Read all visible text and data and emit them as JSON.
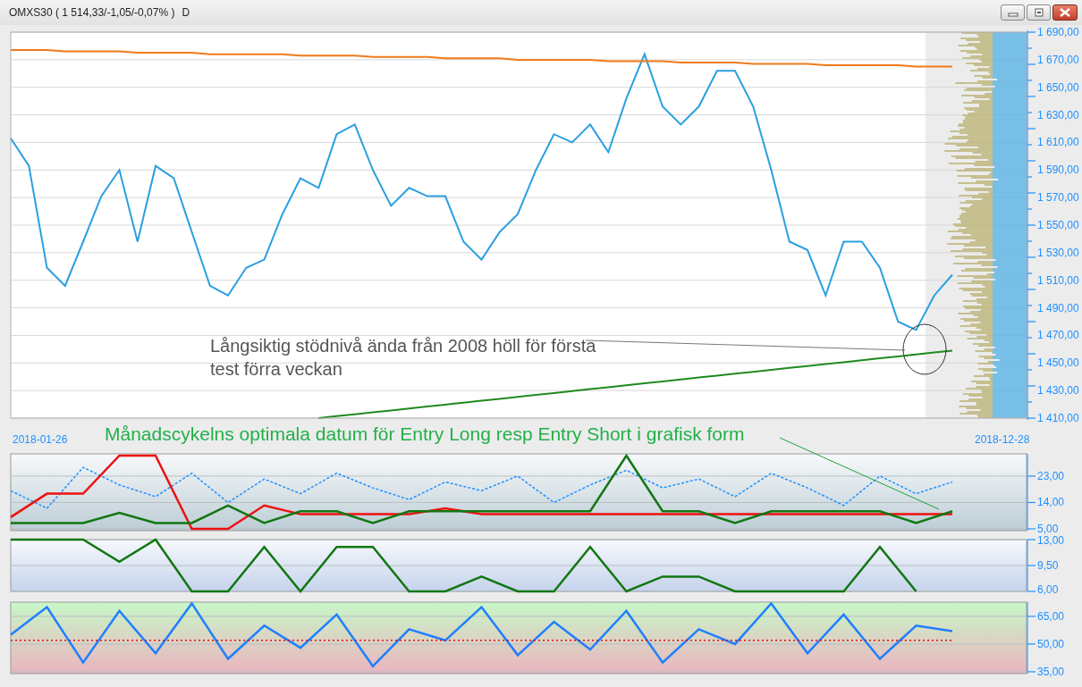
{
  "window": {
    "title": "OMXS30 ( 1 514,33/-1,05/-0,07% )",
    "period": "D"
  },
  "price_chart": {
    "start_date": "2018-01-26",
    "end_date": "2018-12-28",
    "note": "Långsiktig stödnivå ända från 2008 höll för första test förra veckan",
    "chart_data": {
      "type": "line",
      "grid": true,
      "ylim": [
        1410,
        1690
      ],
      "yticks": [
        {
          "value": 1690,
          "label": "1 690,00"
        },
        {
          "value": 1670,
          "label": "1 670,00"
        },
        {
          "value": 1650,
          "label": "1 650,00"
        },
        {
          "value": 1630,
          "label": "1 630,00"
        },
        {
          "value": 1610,
          "label": "1 610,00"
        },
        {
          "value": 1590,
          "label": "1 590,00"
        },
        {
          "value": 1570,
          "label": "1 570,00"
        },
        {
          "value": 1550,
          "label": "1 550,00"
        },
        {
          "value": 1530,
          "label": "1 530,00"
        },
        {
          "value": 1510,
          "label": "1 510,00"
        },
        {
          "value": 1490,
          "label": "1 490,00"
        },
        {
          "value": 1470,
          "label": "1 470,00"
        },
        {
          "value": 1450,
          "label": "1 450,00"
        },
        {
          "value": 1430,
          "label": "1 430,00"
        },
        {
          "value": 1410,
          "label": "1 410,00"
        }
      ],
      "series": [
        {
          "color": "#2a9fe0",
          "line_style": "solid",
          "values": [
            1613,
            1593,
            1519,
            1506,
            1538,
            1571,
            1590,
            1538,
            1593,
            1584,
            1545,
            1506,
            1499,
            1519,
            1525,
            1558,
            1584,
            1577,
            1616,
            1623,
            1590,
            1564,
            1577,
            1571,
            1571,
            1538,
            1525,
            1545,
            1558,
            1590,
            1616,
            1610,
            1623,
            1603,
            1642,
            1674,
            1636,
            1623,
            1636,
            1662,
            1662,
            1636,
            1590,
            1538,
            1532,
            1499,
            1538,
            1538,
            1519,
            1480,
            1474,
            1499,
            1514
          ]
        },
        {
          "color": "#f07a1a",
          "line_style": "solid",
          "values": [
            1677,
            1677,
            1677,
            1676,
            1676,
            1676,
            1676,
            1675,
            1675,
            1675,
            1675,
            1674,
            1674,
            1674,
            1674,
            1674,
            1673,
            1673,
            1673,
            1673,
            1672,
            1672,
            1672,
            1672,
            1671,
            1671,
            1671,
            1671,
            1670,
            1670,
            1670,
            1670,
            1670,
            1669,
            1669,
            1669,
            1669,
            1668,
            1668,
            1668,
            1668,
            1667,
            1667,
            1667,
            1667,
            1666,
            1666,
            1666,
            1666,
            1666,
            1665,
            1665,
            1665
          ]
        },
        {
          "color": "#1e8a1e",
          "line_style": "solid",
          "values": [
            null,
            null,
            null,
            null,
            null,
            null,
            null,
            null,
            null,
            null,
            null,
            null,
            null,
            null,
            null,
            null,
            null,
            1410,
            1411.4,
            1412.8,
            1414.2,
            1415.6,
            1417,
            1418.4,
            1419.8,
            1421.2,
            1422.6,
            1424,
            1425.4,
            1426.8,
            1428.2,
            1429.6,
            1431,
            1432.4,
            1433.8,
            1435.2,
            1436.6,
            1438,
            1439.4,
            1440.8,
            1442.2,
            1443.6,
            1445,
            1446.4,
            1447.8,
            1449.2,
            1450.6,
            1452,
            1453.4,
            1454.8,
            1456.2,
            1457.6,
            1459
          ]
        }
      ]
    }
  },
  "cycle_note": "Månadscykelns optimala datum för Entry Long resp Entry Short i grafisk form",
  "panels": [
    {
      "chart_data": {
        "type": "line",
        "grid": true,
        "ylim": [
          5,
          30.6
        ],
        "yticks": [
          {
            "value": 23,
            "label": "23,00"
          },
          {
            "value": 14,
            "label": "14,00"
          },
          {
            "value": 5,
            "label": "5,00"
          }
        ],
        "series": [
          {
            "color": "#1e90ff",
            "line_style": "dashed",
            "values": [
              18,
              12,
              26,
              20,
              16,
              24,
              14,
              22,
              17,
              24,
              19,
              15,
              21,
              18,
              23,
              14,
              20,
              25,
              19,
              22,
              16,
              24,
              19,
              13,
              23,
              17,
              21
            ]
          },
          {
            "color": "#ee1111",
            "line_style": "solid",
            "values": [
              9,
              17,
              17,
              30,
              30,
              5,
              5,
              13,
              10,
              10,
              10,
              10,
              12,
              10,
              10,
              10,
              10,
              10,
              10,
              10,
              10,
              10,
              10,
              10,
              10,
              10,
              10
            ]
          },
          {
            "color": "#117711",
            "line_style": "solid",
            "values": [
              7,
              7,
              7,
              10.5,
              7,
              7,
              13,
              7,
              11,
              11,
              7,
              11,
              11,
              11,
              11,
              11,
              11,
              30,
              11,
              11,
              7,
              11,
              11,
              11,
              11,
              7,
              11
            ]
          }
        ]
      }
    },
    {
      "chart_data": {
        "type": "line",
        "grid": true,
        "ylim": [
          6,
          13
        ],
        "yticks": [
          {
            "value": 13,
            "label": "13,00"
          },
          {
            "value": 9.5,
            "label": "9,50"
          },
          {
            "value": 6,
            "label": "6,00"
          }
        ],
        "series": [
          {
            "color": "#117711",
            "line_style": "solid",
            "values": [
              13,
              13,
              13,
              10,
              13,
              6,
              6,
              12,
              6,
              12,
              12,
              6,
              6,
              8,
              6,
              6,
              12,
              6,
              8,
              8,
              6,
              6,
              6,
              6,
              12,
              6,
              null
            ]
          }
        ]
      }
    },
    {
      "chart_data": {
        "type": "line",
        "grid": true,
        "ylim": [
          34,
          72.7
        ],
        "yticks": [
          {
            "value": 65,
            "label": "65,00"
          },
          {
            "value": 50,
            "label": "50,00"
          },
          {
            "value": 35,
            "label": "35,00"
          }
        ],
        "series": [
          {
            "color": "#1e7fff",
            "line_style": "solid",
            "values": [
              55,
              70,
              40,
              68,
              45,
              72,
              42,
              60,
              48,
              66,
              38,
              58,
              52,
              70,
              44,
              62,
              47,
              68,
              40,
              58,
              50,
              72,
              45,
              66,
              42,
              60,
              57
            ]
          },
          {
            "color": "#dd1111",
            "line_style": "dotted",
            "values": [
              52,
              52,
              52,
              52,
              52,
              52,
              52,
              52,
              52,
              52,
              52,
              52,
              52,
              52,
              52,
              52,
              52,
              52,
              52,
              52,
              52,
              52,
              52,
              52,
              52,
              52,
              52
            ]
          }
        ]
      }
    }
  ]
}
